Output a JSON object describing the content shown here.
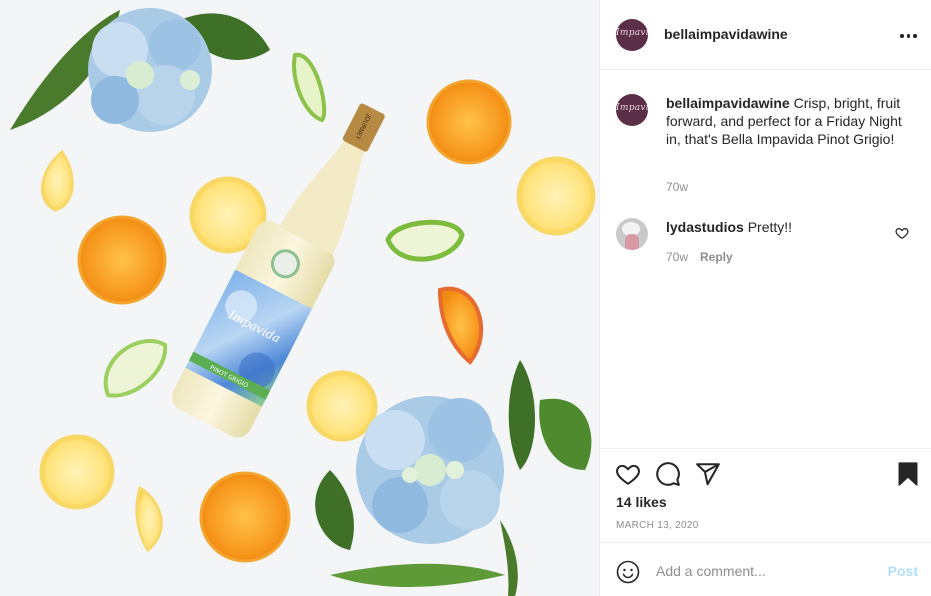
{
  "post": {
    "username": "bellaimpavidawine",
    "avatar_text": "Impavida",
    "image_label_brand": "Impavida",
    "image_label_varietal": "PINOT GRIGIO",
    "image_neck_text": "JOURNEY"
  },
  "caption": {
    "username": "bellaimpavidawine",
    "text": "Crisp, bright, fruit forward, and perfect for a Friday Night in, that's Bella Impavida Pinot Grigio!",
    "time": "70w"
  },
  "comments": [
    {
      "username": "lydastudios",
      "text": "Pretty!!",
      "time": "70w",
      "reply_label": "Reply"
    }
  ],
  "likes": "14 likes",
  "date": "MARCH 13, 2020",
  "add_comment": {
    "placeholder": "Add a comment...",
    "post_label": "Post"
  },
  "icons": {
    "more": "more-options-icon",
    "like": "heart-icon",
    "comment": "comment-bubble-icon",
    "share": "paper-plane-icon",
    "save": "bookmark-icon",
    "emoji": "smiley-icon"
  },
  "colors": {
    "accent_disabled": "#b2dffc",
    "muted": "#8e8e8e",
    "text": "#262626"
  }
}
